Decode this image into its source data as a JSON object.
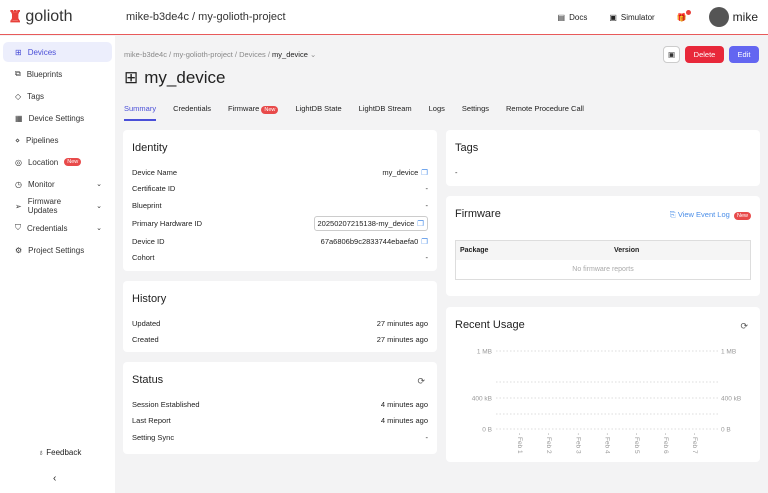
{
  "header": {
    "logo": "golioth",
    "org": "mike-b3de4c",
    "project": "my-golioth-project",
    "docs": "Docs",
    "simulator": "Simulator",
    "user": "mike"
  },
  "sidebar": {
    "items": [
      {
        "label": "Devices"
      },
      {
        "label": "Blueprints"
      },
      {
        "label": "Tags"
      },
      {
        "label": "Device Settings"
      },
      {
        "label": "Pipelines"
      },
      {
        "label": "Location",
        "badge": "New"
      },
      {
        "label": "Monitor"
      },
      {
        "label": "Firmware Updates"
      },
      {
        "label": "Credentials"
      },
      {
        "label": "Project Settings"
      }
    ],
    "feedback": "Feedback"
  },
  "breadcrumb": [
    "mike-b3de4c",
    "my-golioth-project",
    "Devices",
    "my_device"
  ],
  "title": "my_device",
  "buttons": {
    "delete": "Delete",
    "edit": "Edit"
  },
  "tabs": [
    "Summary",
    "Credentials",
    "Firmware",
    "LightDB State",
    "LightDB Stream",
    "Logs",
    "Settings",
    "Remote Procedure Call"
  ],
  "tab_badge": "New",
  "identity": {
    "title": "Identity",
    "rows": [
      [
        "Device Name",
        "my_device"
      ],
      [
        "Certificate ID",
        "-"
      ],
      [
        "Blueprint",
        "-"
      ],
      [
        "Primary Hardware ID",
        "20250207215138-my_device"
      ],
      [
        "Device ID",
        "67a6806b9c2833744ebaefa0"
      ],
      [
        "Cohort",
        "-"
      ]
    ]
  },
  "history": {
    "title": "History",
    "rows": [
      [
        "Updated",
        "27 minutes ago"
      ],
      [
        "Created",
        "27 minutes ago"
      ]
    ]
  },
  "status": {
    "title": "Status",
    "rows": [
      [
        "Session Established",
        "4 minutes ago"
      ],
      [
        "Last Report",
        "4 minutes ago"
      ],
      [
        "Setting Sync",
        "-"
      ]
    ]
  },
  "tags": {
    "title": "Tags",
    "value": "-"
  },
  "firmware": {
    "title": "Firmware",
    "link": "View Event Log",
    "badge": "New",
    "columns": [
      "Package",
      "Version"
    ],
    "empty": "No firmware reports"
  },
  "chart_data": {
    "type": "line",
    "title": "Recent Usage",
    "categories": [
      "Feb 1",
      "Feb 2",
      "Feb 3",
      "Feb 4",
      "Feb 5",
      "Feb 6",
      "Feb 7"
    ],
    "series": [],
    "y_ticks": [
      "1 MB",
      "400 kB",
      "0 B"
    ],
    "grid": true
  }
}
